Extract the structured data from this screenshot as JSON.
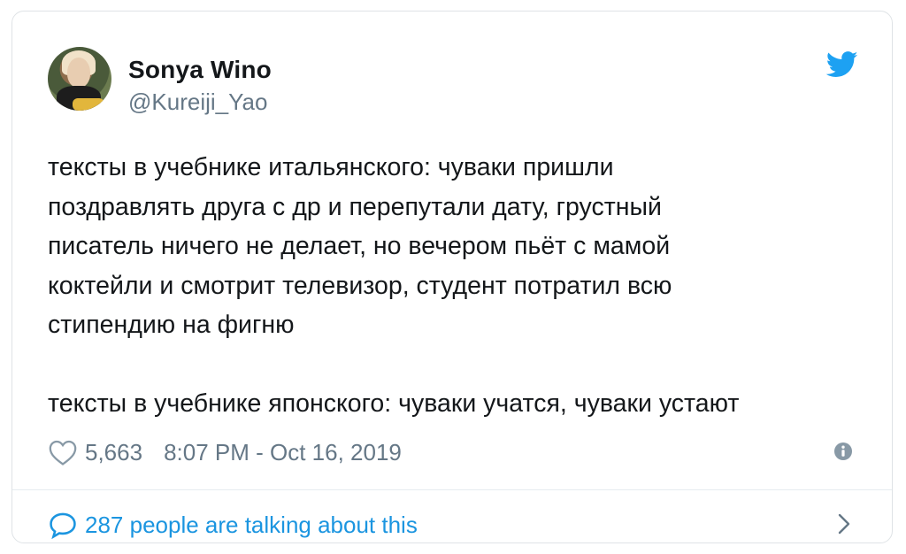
{
  "author": {
    "name": "Sonya Wino",
    "handle": "@Kureiji_Yao"
  },
  "tweet": {
    "text": "тексты в учебнике итальянского: чуваки пришли\nпоздравлять друга с др и перепутали дату, грустный\nписатель ничего не делает, но вечером пьёт с мамой\nкоктейли и смотрит телевизор, студент потратил всю\nстипендию на фигню\n\nтексты в учебнике японского: чуваки учатся, чуваки устают"
  },
  "meta": {
    "likes": "5,663",
    "timestamp": "8:07 PM - Oct 16, 2019"
  },
  "footer": {
    "conversation": "287 people are talking about this"
  },
  "icons": {
    "brand": "twitter-bird-icon",
    "like": "heart-icon",
    "info": "info-icon",
    "reply": "speech-bubble-icon",
    "more": "chevron-right-icon"
  },
  "colors": {
    "brand_blue": "#1da1f2",
    "link_blue": "#1b95e0",
    "secondary_text": "#657786",
    "primary_text": "#14171a"
  }
}
